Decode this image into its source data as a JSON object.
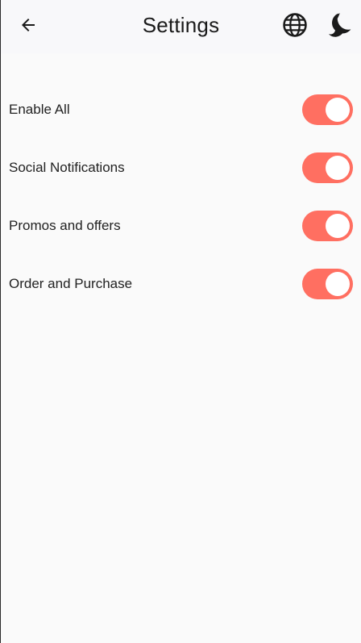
{
  "app_bar": {
    "title": "Settings",
    "back_icon": "arrow-left-icon",
    "language_icon": "globe-icon",
    "theme_icon": "dark-mode-icon"
  },
  "settings": [
    {
      "label": "Enable All",
      "enabled": true
    },
    {
      "label": "Social Notifications",
      "enabled": true
    },
    {
      "label": "Promos and offers",
      "enabled": true
    },
    {
      "label": "Order and Purchase",
      "enabled": true
    }
  ],
  "colors": {
    "accent": "#ff6f61",
    "background": "#fafafa",
    "app_bar": "#f8f8fa",
    "text": "#1a1a1a"
  }
}
